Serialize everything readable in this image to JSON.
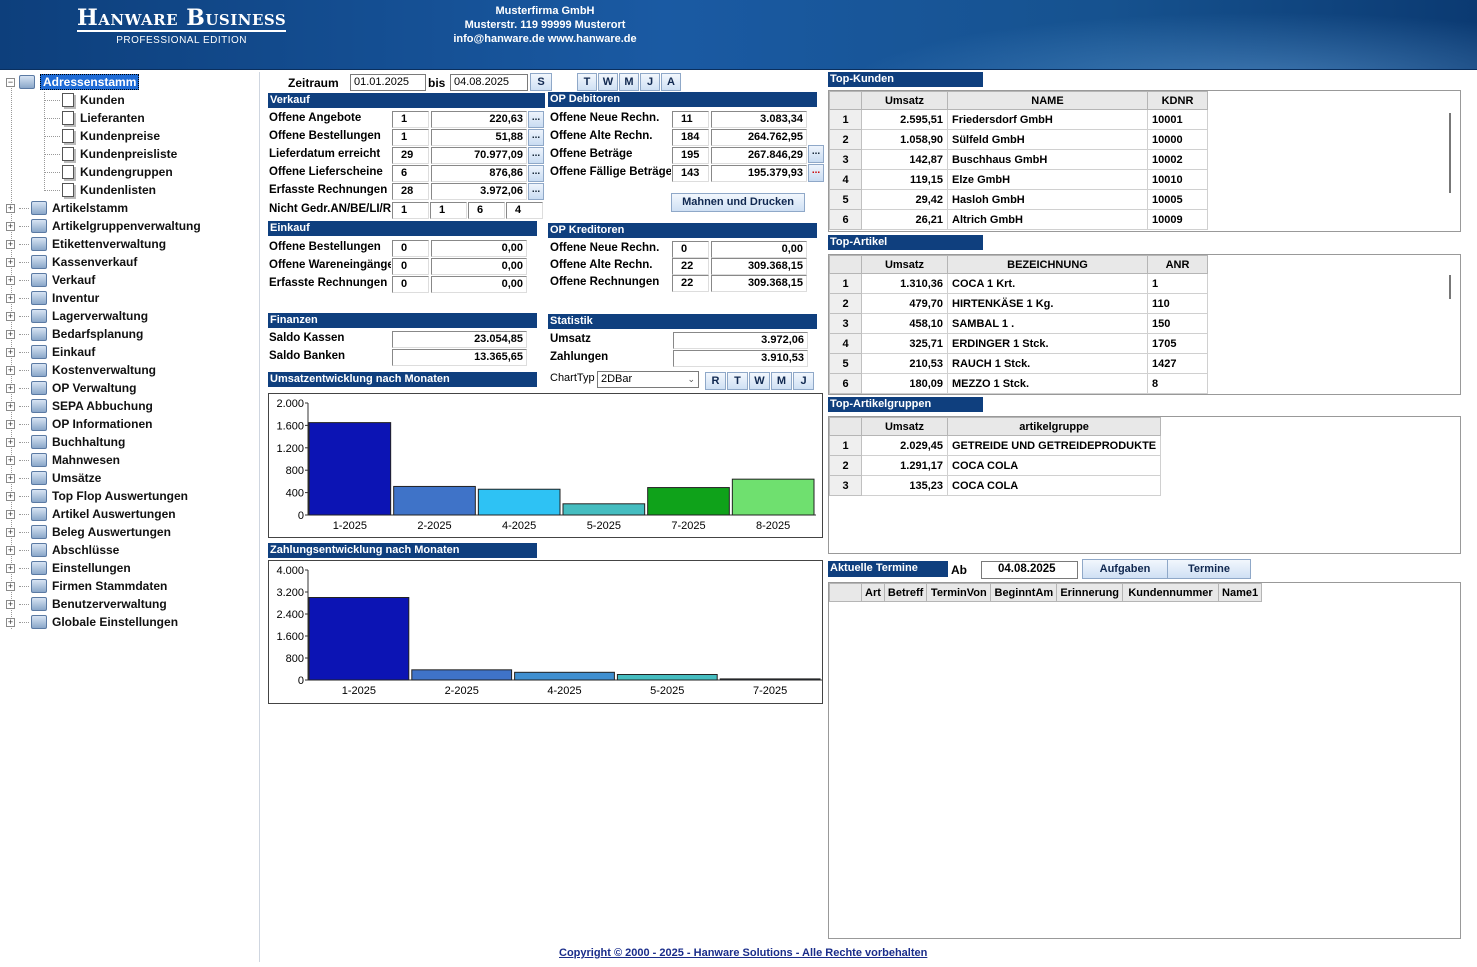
{
  "header": {
    "brand": "Hanware Business",
    "edition": "PROFESSIONAL EDITION",
    "company_name": "Musterfirma GmbH",
    "company_address": "Musterstr. 119 99999 Musterort",
    "company_contact": "info@hanware.de  www.hanware.de"
  },
  "tree": {
    "root": "Adressenstamm",
    "children": [
      "Kunden",
      "Lieferanten",
      "Kundenpreise",
      "Kundenpreisliste",
      "Kundengruppen",
      "Kundenlisten"
    ],
    "items": [
      "Artikelstamm",
      "Artikelgruppenverwaltung",
      "Etikettenverwaltung",
      "Kassenverkauf",
      "Verkauf",
      "Inventur",
      "Lagerverwaltung",
      "Bedarfsplanung",
      "Einkauf",
      "Kostenverwaltung",
      "OP Verwaltung",
      "SEPA Abbuchung",
      "OP Informationen",
      "Buchhaltung",
      "Mahnwesen",
      "Umsätze",
      "Top Flop Auswertungen",
      "Artikel Auswertungen",
      "Beleg Auswertungen",
      "Abschlüsse",
      "Einstellungen",
      "Firmen Stammdaten",
      "Benutzerverwaltung",
      "Globale Einstellungen"
    ]
  },
  "period": {
    "label": "Zeitraum",
    "from": "01.01.2025",
    "to_label": "bis",
    "to": "04.08.2025",
    "s_button": "S",
    "quick_buttons": [
      "T",
      "W",
      "M",
      "J",
      "A"
    ]
  },
  "verkauf": {
    "title": "Verkauf",
    "rows": [
      {
        "label": "Offene Angebote",
        "count": "1",
        "amount": "220,63"
      },
      {
        "label": "Offene Bestellungen",
        "count": "1",
        "amount": "51,88"
      },
      {
        "label": "Lieferdatum erreicht",
        "count": "29",
        "amount": "70.977,09"
      },
      {
        "label": "Offene Lieferscheine",
        "count": "6",
        "amount": "876,86"
      },
      {
        "label": "Erfasste Rechnungen",
        "count": "28",
        "amount": "3.972,06"
      }
    ],
    "nicht_label": "Nicht Gedr.AN/BE/LI/RE",
    "nicht_values": [
      "1",
      "1",
      "6",
      "4"
    ]
  },
  "op_debitoren": {
    "title": "OP Debitoren",
    "rows": [
      {
        "label": "Offene Neue Rechn.",
        "count": "11",
        "amount": "3.083,34"
      },
      {
        "label": "Offene Alte Rechn.",
        "count": "184",
        "amount": "264.762,95"
      },
      {
        "label": "Offene Beträge",
        "count": "195",
        "amount": "267.846,29"
      },
      {
        "label": "Offene Fällige Beträge",
        "count": "143",
        "amount": "195.379,93"
      }
    ],
    "mahnen_button": "Mahnen und Drucken"
  },
  "einkauf": {
    "title": "Einkauf",
    "rows": [
      {
        "label": "Offene Bestellungen",
        "count": "0",
        "amount": "0,00"
      },
      {
        "label": "Offene Wareneingänge",
        "count": "0",
        "amount": "0,00"
      },
      {
        "label": "Erfasste Rechnungen",
        "count": "0",
        "amount": "0,00"
      }
    ]
  },
  "op_kreditoren": {
    "title": "OP Kreditoren",
    "rows": [
      {
        "label": "Offene Neue Rechn.",
        "count": "0",
        "amount": "0,00"
      },
      {
        "label": "Offene Alte Rechn.",
        "count": "22",
        "amount": "309.368,15"
      },
      {
        "label": "Offene Rechnungen",
        "count": "22",
        "amount": "309.368,15"
      }
    ]
  },
  "finanzen": {
    "title": "Finanzen",
    "rows": [
      {
        "label": "Saldo Kassen",
        "amount": "23.054,85"
      },
      {
        "label": "Saldo Banken",
        "amount": "13.365,65"
      }
    ]
  },
  "statistik": {
    "title": "Statistik",
    "rows": [
      {
        "label": "Umsatz",
        "amount": "3.972,06"
      },
      {
        "label": "Zahlungen",
        "amount": "3.910,53"
      }
    ]
  },
  "chart_controls": {
    "label": "ChartTyp",
    "value": "2DBar",
    "buttons": [
      "R",
      "T",
      "W",
      "M",
      "J"
    ]
  },
  "chart_data": [
    {
      "type": "bar",
      "title": "Umsatzentwicklung nach Monaten",
      "categories": [
        "1-2025",
        "2-2025",
        "4-2025",
        "5-2025",
        "7-2025",
        "8-2025"
      ],
      "values": [
        1650,
        510,
        460,
        200,
        490,
        640
      ],
      "colors": [
        "#0c14b4",
        "#3f73c8",
        "#2ec2f4",
        "#45bdc0",
        "#0fa21a",
        "#6fe06f"
      ],
      "ylim": [
        0,
        2000
      ],
      "yticks": [
        "0",
        "400",
        "800",
        "1.200",
        "1.600",
        "2.000"
      ],
      "ytick_values": [
        0,
        400,
        800,
        1200,
        1600,
        2000
      ]
    },
    {
      "type": "bar",
      "title": "Zahlungsentwicklung nach Monaten",
      "categories": [
        "1-2025",
        "2-2025",
        "4-2025",
        "5-2025",
        "7-2025"
      ],
      "values": [
        3000,
        370,
        280,
        200,
        40
      ],
      "colors": [
        "#0c14b4",
        "#3f73c8",
        "#3f8fd0",
        "#45bdc0",
        "#2f4b7a"
      ],
      "ylim": [
        0,
        4000
      ],
      "yticks": [
        "0",
        "800",
        "1.600",
        "2.400",
        "3.200",
        "4.000"
      ],
      "ytick_values": [
        0,
        800,
        1600,
        2400,
        3200,
        4000
      ]
    }
  ],
  "top_kunden": {
    "title": "Top-Kunden",
    "columns": [
      "Umsatz",
      "NAME",
      "KDNR"
    ],
    "rows": [
      [
        "1",
        "2.595,51",
        "Friedersdorf GmbH",
        "10001"
      ],
      [
        "2",
        "1.058,90",
        "Sülfeld GmbH",
        "10000"
      ],
      [
        "3",
        "142,87",
        "Buschhaus GmbH",
        "10002"
      ],
      [
        "4",
        "119,15",
        "Elze GmbH",
        "10010"
      ],
      [
        "5",
        "29,42",
        "Hasloh GmbH",
        "10005"
      ],
      [
        "6",
        "26,21",
        "Altrich GmbH",
        "10009"
      ]
    ]
  },
  "top_artikel": {
    "title": "Top-Artikel",
    "columns": [
      "Umsatz",
      "BEZEICHNUNG",
      "ANR"
    ],
    "rows": [
      [
        "1",
        "1.310,36",
        "COCA 1 Krt.",
        "1"
      ],
      [
        "2",
        "479,70",
        "HIRTENKÄSE 1 Kg.",
        "110"
      ],
      [
        "3",
        "458,10",
        "SAMBAL 1 .",
        "150"
      ],
      [
        "4",
        "325,71",
        "ERDINGER 1 Stck.",
        "1705"
      ],
      [
        "5",
        "210,53",
        "RAUCH 1 Stck.",
        "1427"
      ],
      [
        "6",
        "180,09",
        "MEZZO 1 Stck.",
        "8"
      ]
    ]
  },
  "top_artikelgruppen": {
    "title": "Top-Artikelgruppen",
    "columns": [
      "Umsatz",
      "artikelgruppe"
    ],
    "rows": [
      [
        "1",
        "2.029,45",
        "GETREIDE UND GETREIDEPRODUKTE"
      ],
      [
        "2",
        "1.291,17",
        "COCA COLA"
      ],
      [
        "3",
        "135,23",
        "COCA COLA"
      ]
    ]
  },
  "termine": {
    "title": "Aktuelle Termine",
    "ab_label": "Ab",
    "date": "04.08.2025",
    "aufgaben_button": "Aufgaben",
    "termine_button": "Termine",
    "columns": [
      "Art",
      "Betreff",
      "TerminVon",
      "BeginntAm",
      "Erinnerung",
      "Kundennummer",
      "Name1"
    ]
  },
  "footer": "Copyright © 2000 - 2025 - Hanware Solutions - Alle Rechte vorbehalten"
}
